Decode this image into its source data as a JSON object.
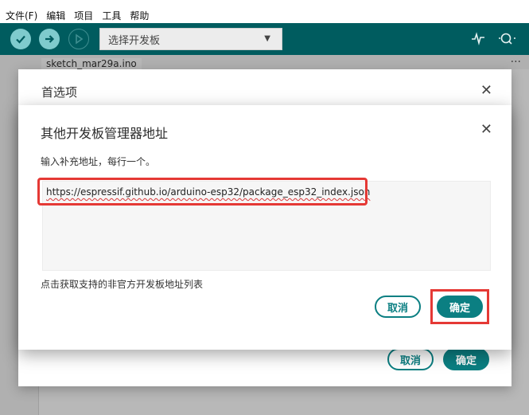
{
  "menubar": {
    "items": [
      "文件(F)",
      "编辑",
      "项目",
      "工具",
      "帮助"
    ]
  },
  "toolbar": {
    "board_select_label": "选择开发板"
  },
  "editor": {
    "tab_label": "sketch_mar29a.ino",
    "tab_more": "···"
  },
  "preferences_dialog": {
    "title": "首选项",
    "cancel_label": "取消",
    "ok_label": "确定"
  },
  "url_dialog": {
    "title": "其他开发板管理器地址",
    "instruction": "输入补充地址，每行一个。",
    "url_value": "https://espressif.github.io/arduino-esp32/package_esp32_index.json",
    "unofficial_link": "点击获取支持的非官方开发板地址列表",
    "cancel_label": "取消",
    "ok_label": "确定"
  },
  "colors": {
    "toolbar": "#005c5f",
    "accent": "#0b7f82",
    "highlight": "#e53935"
  },
  "icons": [
    "verify-icon",
    "upload-icon",
    "debug-icon",
    "serial-plotter-icon",
    "serial-monitor-icon",
    "close-icon"
  ]
}
